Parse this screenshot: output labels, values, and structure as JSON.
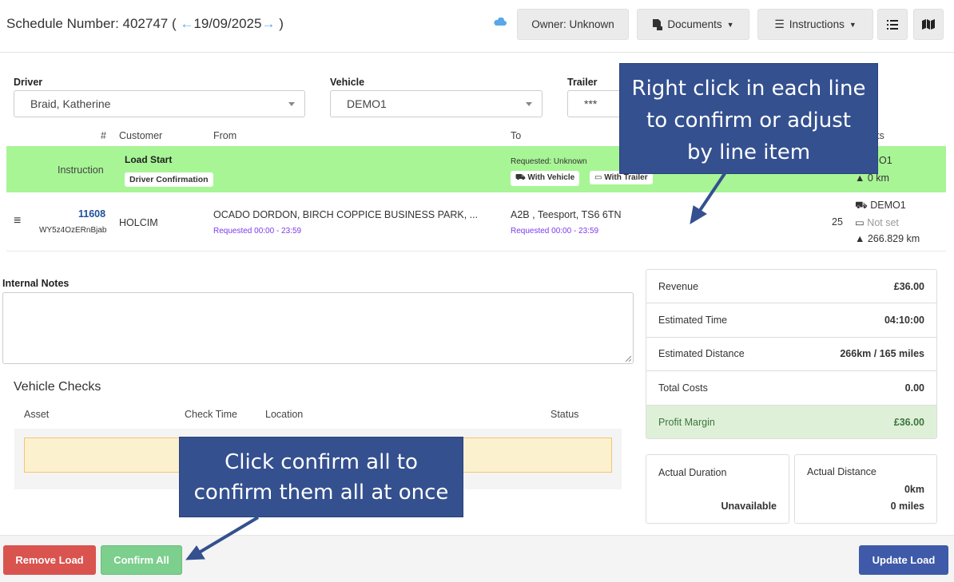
{
  "header": {
    "schedule_label": "Schedule Number: 402747 (",
    "prev_arrow": "←",
    "date": "19/09/2025",
    "next_arrow": "→",
    "close_paren": ")",
    "owner_label": "Owner: Unknown",
    "documents_label": "Documents",
    "instructions_label": "Instructions"
  },
  "form": {
    "driver_label": "Driver",
    "driver_value": "Braid, Katherine",
    "vehicle_label": "Vehicle",
    "vehicle_value": "DEMO1",
    "trailer_label": "Trailer",
    "trailer_value": "***"
  },
  "table": {
    "headers": {
      "num": "#",
      "customer": "Customer",
      "from": "From",
      "to": "To",
      "units_partial": "ts"
    },
    "start_row": {
      "type": "Instruction",
      "title": "Load Start",
      "badge": "Driver Confirmation",
      "requested": "Requested: Unknown",
      "with_vehicle": "With Vehicle",
      "with_trailer": "With Trailer",
      "vehicle_partial": "O1",
      "distance": "0 km"
    },
    "item_row": {
      "number": "11608",
      "ref": "WY5z4OzERnBjab",
      "customer": "HOLCIM",
      "from": "OCADO DORDON, BIRCH COPPICE BUSINESS PARK, ...",
      "from_requested": "Requested 00:00 - 23:59",
      "to": "A2B , Teesport, TS6 6TN",
      "to_requested": "Requested 00:00 - 23:59",
      "qty": "25",
      "vehicle": "DEMO1",
      "trailer": "Not set",
      "distance": "266.829 km"
    }
  },
  "notes": {
    "label": "Internal Notes"
  },
  "vehicle_checks": {
    "title": "Vehicle Checks",
    "headers": {
      "asset": "Asset",
      "check_time": "Check Time",
      "location": "Location",
      "status": "Status"
    }
  },
  "summary": {
    "revenue_label": "Revenue",
    "revenue_value": "£36.00",
    "time_label": "Estimated Time",
    "time_value": "04:10:00",
    "distance_label": "Estimated Distance",
    "distance_value": "266km / 165 miles",
    "costs_label": "Total Costs",
    "costs_value": "0.00",
    "margin_label": "Profit Margin",
    "margin_value": "£36.00",
    "actual_duration_label": "Actual Duration",
    "actual_duration_value": "Unavailable",
    "actual_distance_label": "Actual Distance",
    "actual_distance_km": "0km",
    "actual_distance_miles": "0 miles"
  },
  "footer": {
    "remove_label": "Remove Load",
    "confirm_all_label": "Confirm All",
    "update_label": "Update Load"
  },
  "callouts": {
    "right_click": [
      "Right click in each line",
      "to confirm or adjust",
      "by line item"
    ],
    "confirm_all": [
      "Click confirm all to",
      "confirm them all at once"
    ]
  },
  "colors": {
    "green_row": "#a8f596",
    "callout": "#34508f",
    "remove": "#d9534f",
    "confirm": "#7ccf8d",
    "update": "#3e5aa8",
    "link_blue": "#1f4f9c"
  }
}
